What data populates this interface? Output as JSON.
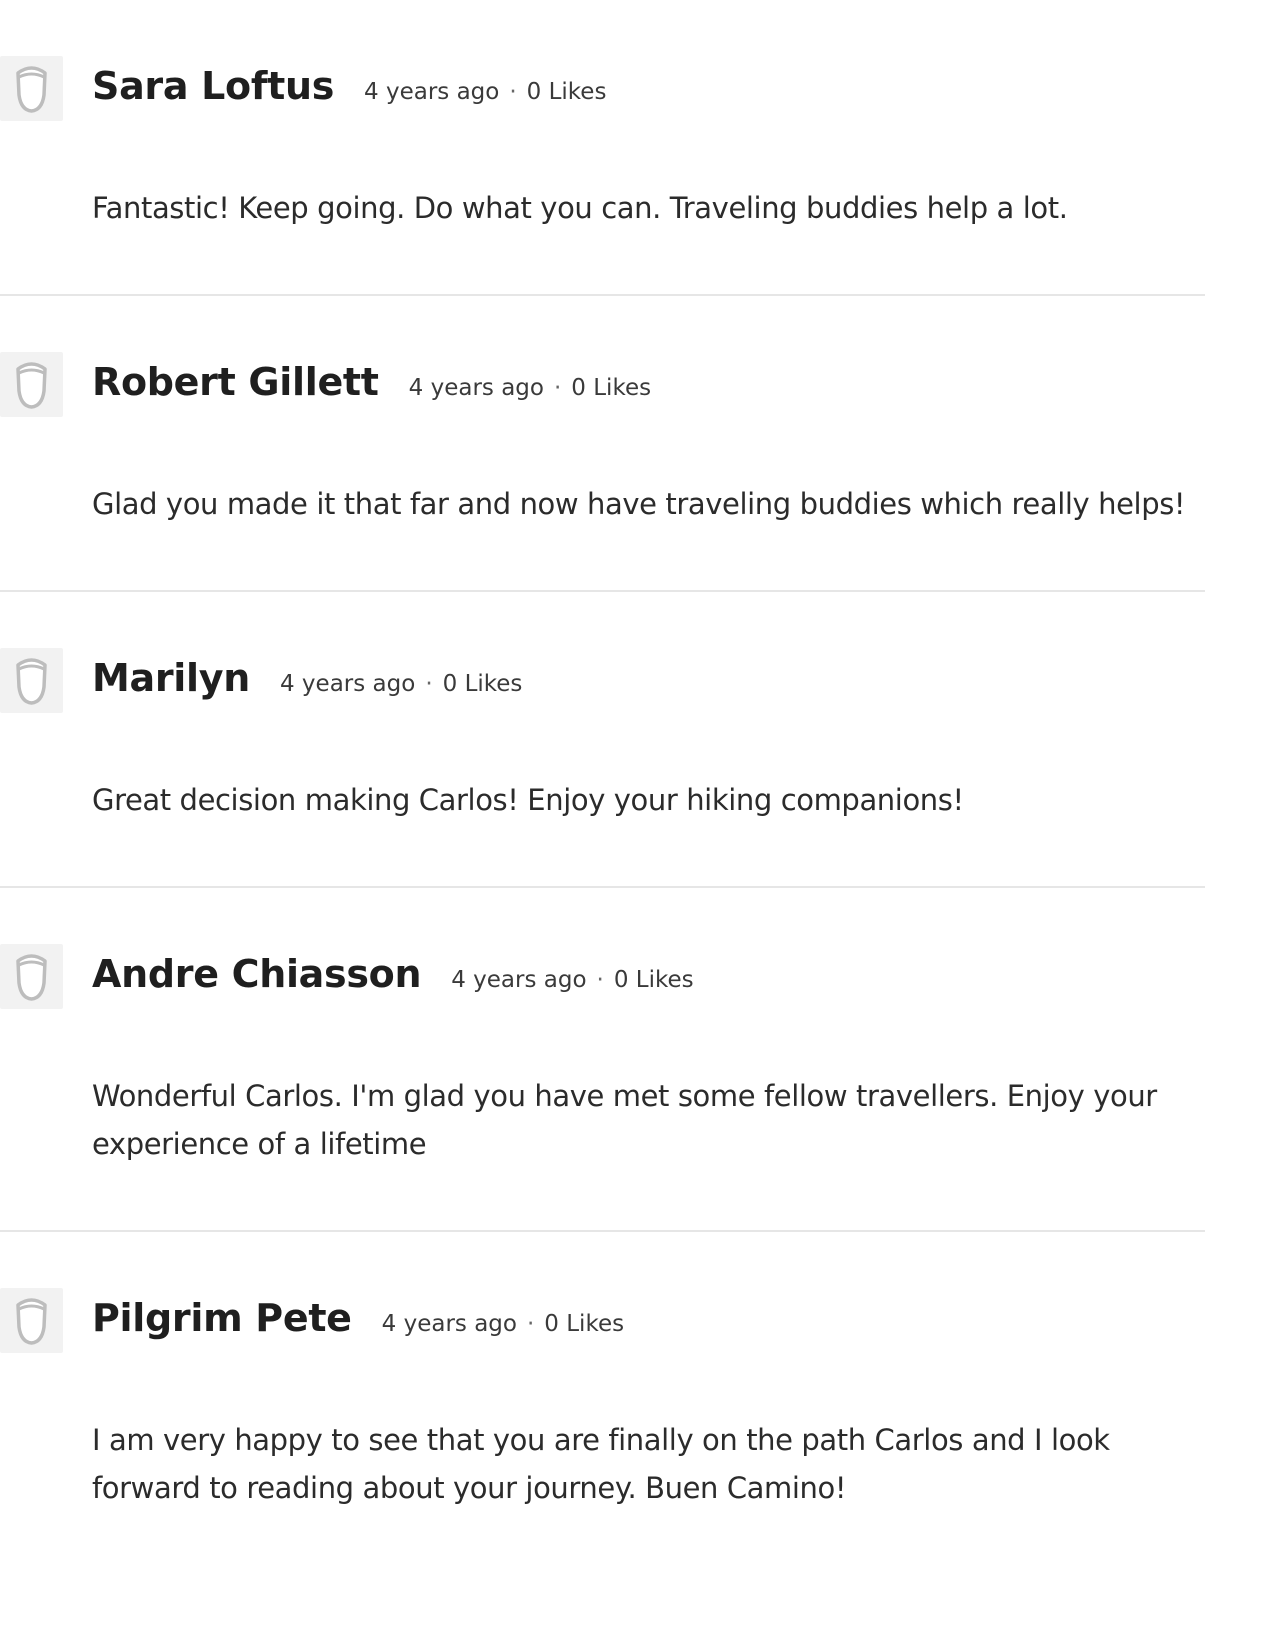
{
  "comments": [
    {
      "author": "Sara Loftus",
      "time": "4 years ago",
      "separator": "·",
      "likes": "0 Likes",
      "text": "Fantastic! Keep going. Do what you can. Traveling buddies help a lot.",
      "avatar_icon": "default-avatar-icon"
    },
    {
      "author": "Robert Gillett",
      "time": "4 years ago",
      "separator": "·",
      "likes": "0 Likes",
      "text": "Glad you made it that far and now have traveling buddies which really helps!",
      "avatar_icon": "default-avatar-icon"
    },
    {
      "author": "Marilyn",
      "time": "4 years ago",
      "separator": "·",
      "likes": "0 Likes",
      "text": "Great decision making Carlos! Enjoy your hiking companions!",
      "avatar_icon": "default-avatar-icon"
    },
    {
      "author": "Andre Chiasson",
      "time": "4 years ago",
      "separator": "·",
      "likes": "0 Likes",
      "text": "Wonderful Carlos. I'm glad you have met some fellow travellers. Enjoy your experience of a lifetime",
      "avatar_icon": "default-avatar-icon"
    },
    {
      "author": "Pilgrim Pete",
      "time": "4 years ago",
      "separator": "·",
      "likes": "0 Likes",
      "text": "I am very happy to see that you are finally on the path Carlos and I look forward to reading about your journey. Buen Camino!",
      "avatar_icon": "default-avatar-icon"
    }
  ],
  "colors": {
    "avatar_bg": "#f2f2f2",
    "avatar_outline": "#bdbdbd",
    "divider": "#e6e6e6",
    "text": "#262626"
  }
}
